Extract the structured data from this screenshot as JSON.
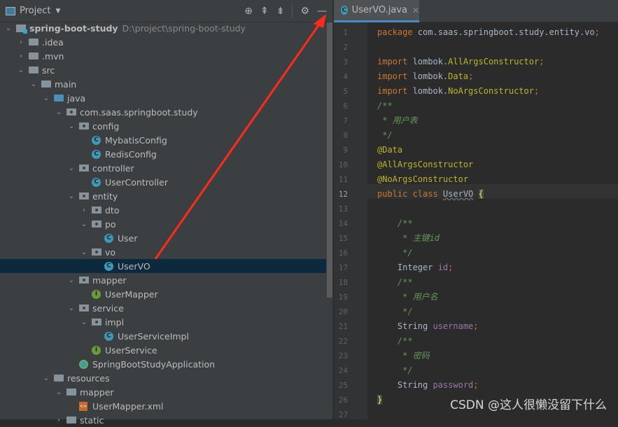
{
  "project_panel": {
    "title": "Project",
    "tools": [
      "locate-icon",
      "expand-all-icon",
      "collapse-all-icon",
      "gear-icon",
      "minimize-icon"
    ],
    "tree": [
      {
        "d": 0,
        "a": "open",
        "i": "mod",
        "label": "spring-boot-study",
        "path": "D:\\project\\spring-boot-study",
        "bold": true
      },
      {
        "d": 1,
        "a": "closed",
        "i": "folder",
        "label": ".idea"
      },
      {
        "d": 1,
        "a": "closed",
        "i": "folder",
        "label": ".mvn"
      },
      {
        "d": 1,
        "a": "open",
        "i": "folder",
        "label": "src"
      },
      {
        "d": 2,
        "a": "open",
        "i": "folder",
        "label": "main"
      },
      {
        "d": 3,
        "a": "open",
        "i": "folder blue",
        "label": "java"
      },
      {
        "d": 4,
        "a": "open",
        "i": "pkg",
        "label": "com.saas.springboot.study"
      },
      {
        "d": 5,
        "a": "open",
        "i": "pkg",
        "label": "config"
      },
      {
        "d": 6,
        "i": "cls",
        "label": "MybatisConfig"
      },
      {
        "d": 6,
        "i": "cls",
        "label": "RedisConfig"
      },
      {
        "d": 5,
        "a": "open",
        "i": "pkg",
        "label": "controller"
      },
      {
        "d": 6,
        "i": "cls",
        "label": "UserController"
      },
      {
        "d": 5,
        "a": "open",
        "i": "pkg",
        "label": "entity"
      },
      {
        "d": 6,
        "a": "closed",
        "i": "pkg",
        "label": "dto"
      },
      {
        "d": 6,
        "a": "open",
        "i": "pkg",
        "label": "po"
      },
      {
        "d": 7,
        "i": "cls",
        "label": "User"
      },
      {
        "d": 6,
        "a": "open",
        "i": "pkg",
        "label": "vo"
      },
      {
        "d": 7,
        "i": "cls",
        "label": "UserVO",
        "selected": true
      },
      {
        "d": 5,
        "a": "open",
        "i": "pkg",
        "label": "mapper"
      },
      {
        "d": 6,
        "i": "itf",
        "label": "UserMapper"
      },
      {
        "d": 5,
        "a": "open",
        "i": "pkg",
        "label": "service"
      },
      {
        "d": 6,
        "a": "open",
        "i": "pkg",
        "label": "impl"
      },
      {
        "d": 7,
        "i": "cls",
        "label": "UserServiceImpl"
      },
      {
        "d": 6,
        "i": "itf",
        "label": "UserService"
      },
      {
        "d": 5,
        "i": "spr",
        "label": "SpringBootStudyApplication"
      },
      {
        "d": 3,
        "a": "open",
        "i": "folder",
        "label": "resources"
      },
      {
        "d": 4,
        "a": "open",
        "i": "folder",
        "label": "mapper"
      },
      {
        "d": 5,
        "i": "xml",
        "label": "UserMapper.xml"
      },
      {
        "d": 4,
        "a": "closed",
        "i": "folder",
        "label": "static"
      }
    ]
  },
  "editor": {
    "tab": "UserVO.java",
    "current_line": 12,
    "lines": [
      [
        [
          "kw",
          "package "
        ],
        [
          "",
          "com.saas.springboot.study.entity.vo"
        ],
        [
          "kw",
          ";"
        ]
      ],
      [],
      [
        [
          "kw",
          "import "
        ],
        [
          "",
          "lombok."
        ],
        [
          "ann",
          "AllArgsConstructor"
        ],
        [
          "kw",
          ";"
        ]
      ],
      [
        [
          "kw",
          "import "
        ],
        [
          "",
          "lombok."
        ],
        [
          "ann",
          "Data"
        ],
        [
          "kw",
          ";"
        ]
      ],
      [
        [
          "kw",
          "import "
        ],
        [
          "",
          "lombok."
        ],
        [
          "ann",
          "NoArgsConstructor"
        ],
        [
          "kw",
          ";"
        ]
      ],
      [
        [
          "cm",
          "/**"
        ]
      ],
      [
        [
          "cm",
          " * 用户表"
        ]
      ],
      [
        [
          "cm",
          " */"
        ]
      ],
      [
        [
          "ann",
          "@Data"
        ]
      ],
      [
        [
          "ann",
          "@AllArgsConstructor"
        ]
      ],
      [
        [
          "ann",
          "@NoArgsConstructor"
        ]
      ],
      [
        [
          "kw",
          "public class "
        ],
        [
          "wavy",
          "UserVO"
        ],
        [
          "",
          " "
        ],
        [
          "brace",
          "{"
        ]
      ],
      [],
      [
        [
          "cm",
          "    /**"
        ]
      ],
      [
        [
          "cm",
          "     * 主键id"
        ]
      ],
      [
        [
          "cm",
          "     */"
        ]
      ],
      [
        [
          "",
          "    Integer "
        ],
        [
          "fld",
          "id"
        ],
        [
          "kw",
          ";"
        ]
      ],
      [
        [
          "cm",
          "    /**"
        ]
      ],
      [
        [
          "cm",
          "     * 用户名"
        ]
      ],
      [
        [
          "cm",
          "     */"
        ]
      ],
      [
        [
          "",
          "    String "
        ],
        [
          "fld",
          "username"
        ],
        [
          "kw",
          ";"
        ]
      ],
      [
        [
          "cm",
          "    /**"
        ]
      ],
      [
        [
          "cm",
          "     * 密码"
        ]
      ],
      [
        [
          "cm",
          "     */"
        ]
      ],
      [
        [
          "",
          "    String "
        ],
        [
          "fld",
          "password"
        ],
        [
          "kw",
          ";"
        ]
      ],
      [
        [
          "brace",
          "}"
        ]
      ],
      []
    ]
  },
  "watermark": "CSDN @这人很懒没留下什么",
  "colors": {
    "annotation_arrow": "#ff2a1a",
    "selection": "#0d293e"
  }
}
